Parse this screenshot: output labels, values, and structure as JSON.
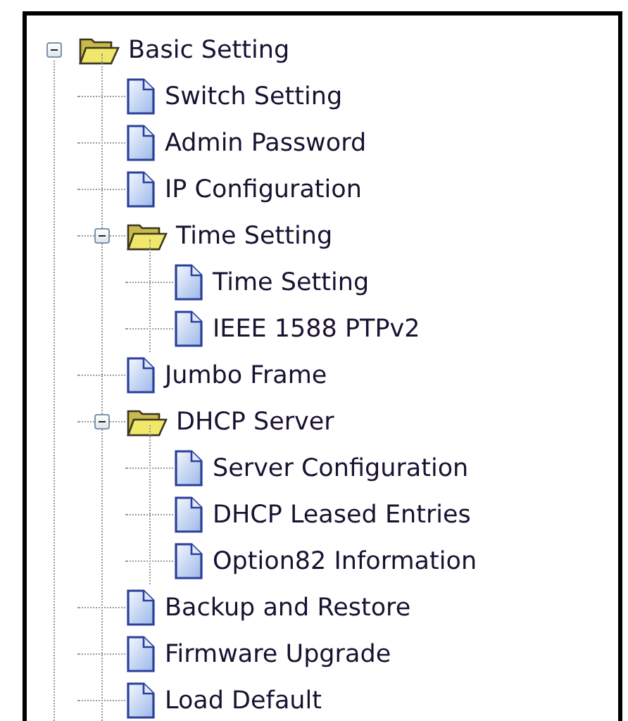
{
  "tree": [
    {
      "kind": "folder",
      "label": "Basic Setting",
      "expanded": true,
      "children": [
        {
          "kind": "page",
          "label": "Switch Setting"
        },
        {
          "kind": "page",
          "label": "Admin Password"
        },
        {
          "kind": "page",
          "label": "IP Configuration"
        },
        {
          "kind": "folder",
          "label": "Time Setting",
          "expanded": true,
          "children": [
            {
              "kind": "page",
              "label": "Time Setting"
            },
            {
              "kind": "page",
              "label": "IEEE 1588 PTPv2"
            }
          ]
        },
        {
          "kind": "page",
          "label": "Jumbo Frame"
        },
        {
          "kind": "folder",
          "label": "DHCP Server",
          "expanded": true,
          "children": [
            {
              "kind": "page",
              "label": "Server Configuration"
            },
            {
              "kind": "page",
              "label": "DHCP Leased Entries"
            },
            {
              "kind": "page",
              "label": "Option82 Information"
            }
          ]
        },
        {
          "kind": "page",
          "label": "Backup and Restore"
        },
        {
          "kind": "page",
          "label": "Firmware Upgrade"
        },
        {
          "kind": "page",
          "label": "Load Default"
        }
      ]
    }
  ]
}
